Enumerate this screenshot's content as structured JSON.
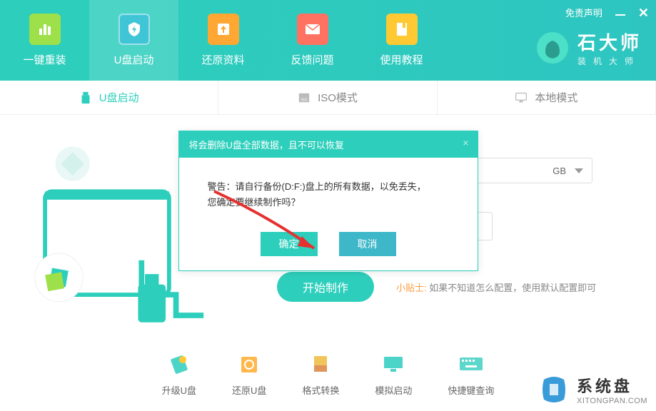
{
  "window": {
    "disclaimer": "免责声明"
  },
  "nav": {
    "items": [
      {
        "label": "一键重装"
      },
      {
        "label": "U盘启动"
      },
      {
        "label": "还原资料"
      },
      {
        "label": "反馈问题"
      },
      {
        "label": "使用教程"
      }
    ]
  },
  "logo": {
    "title": "石大师",
    "subtitle": "装机大师"
  },
  "sub_tabs": {
    "items": [
      {
        "label": "U盘启动"
      },
      {
        "label": "ISO模式"
      },
      {
        "label": "本地模式"
      }
    ]
  },
  "form": {
    "dropdown_value": "GB"
  },
  "actions": {
    "start": "开始制作"
  },
  "tip": {
    "label": "小贴士:",
    "text": "如果不知道怎么配置，使用默认配置即可"
  },
  "tools": {
    "items": [
      {
        "label": "升级U盘"
      },
      {
        "label": "还原U盘"
      },
      {
        "label": "格式转换"
      },
      {
        "label": "模拟启动"
      },
      {
        "label": "快捷键查询"
      }
    ]
  },
  "modal": {
    "title": "将会删除U盘全部数据，且不可以恢复",
    "body_line1": "警告：请自行备份(D:F:)盘上的所有数据，以免丢失，",
    "body_line2": "您确定要继续制作吗？",
    "confirm": "确定",
    "cancel": "取消"
  },
  "watermark": {
    "title": "系统盘",
    "url": "XITONGPAN.COM"
  }
}
